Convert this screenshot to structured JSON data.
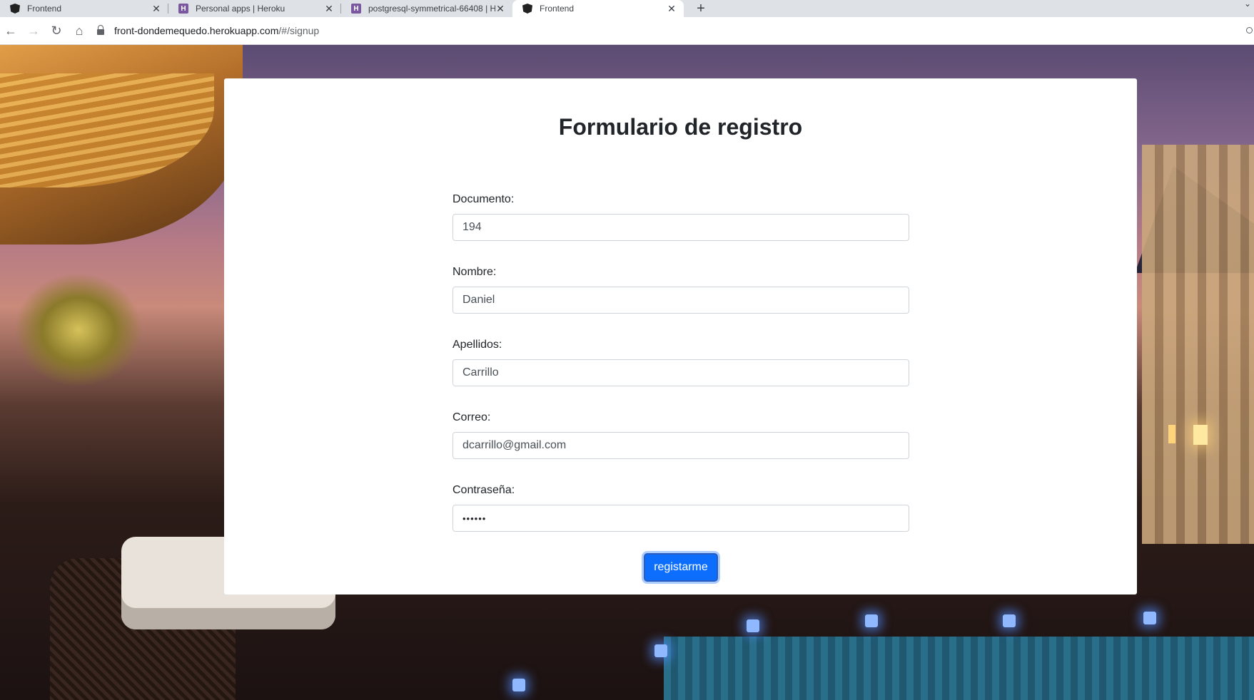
{
  "browser": {
    "tabs": [
      {
        "title": "Frontend",
        "favicon": "angular-icon"
      },
      {
        "title": "Personal apps | Heroku",
        "favicon": "heroku-icon"
      },
      {
        "title": "postgresql-symmetrical-66408 | H",
        "favicon": "heroku-icon"
      },
      {
        "title": "Frontend",
        "favicon": "angular-icon",
        "active": true
      }
    ],
    "url_host": "front-dondemequedo.herokuapp.com",
    "url_path": "/#/signup"
  },
  "form": {
    "title": "Formulario de registro",
    "fields": [
      {
        "label": "Documento:",
        "value": "194"
      },
      {
        "label": "Nombre:",
        "value": "Daniel"
      },
      {
        "label": "Apellidos:",
        "value": "Carrillo"
      },
      {
        "label": "Correo:",
        "value": "dcarrillo@gmail.com"
      },
      {
        "label": "Contraseña:",
        "value": "••••••"
      }
    ],
    "submit_label": "registarme"
  },
  "colors": {
    "primary_button": "#0d6efd",
    "card_background": "#ffffff",
    "heading_text": "#212529"
  }
}
